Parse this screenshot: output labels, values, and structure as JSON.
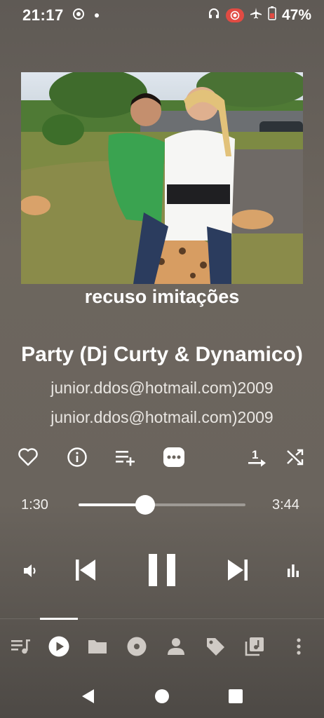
{
  "status_bar": {
    "time": "21:17",
    "battery_percent": "47%"
  },
  "album": {
    "caption": "recuso imitações"
  },
  "track": {
    "title": "Party (Dj Curty & Dynamico)",
    "artist": "junior.ddos@hotmail.com)2009",
    "album": "junior.ddos@hotmail.com)2009"
  },
  "playback": {
    "current_time": "1:30",
    "total_time": "3:44",
    "progress_fraction": 0.4,
    "state": "playing"
  },
  "action_icons": [
    "heart-icon",
    "info-icon",
    "add-to-queue-icon",
    "more-options-icon",
    "repeat-one-icon",
    "shuffle-icon"
  ],
  "bottom_nav": {
    "items": [
      "queue-icon",
      "now-playing-icon",
      "folder-icon",
      "album-icon",
      "artist-icon",
      "tag-icon",
      "playlist-icon",
      "overflow-menu-icon"
    ],
    "selected": "now-playing-icon"
  },
  "colors": {
    "accent": "#ffffff",
    "record_badge": "#e14b43",
    "battery_level": "#e14b43"
  }
}
